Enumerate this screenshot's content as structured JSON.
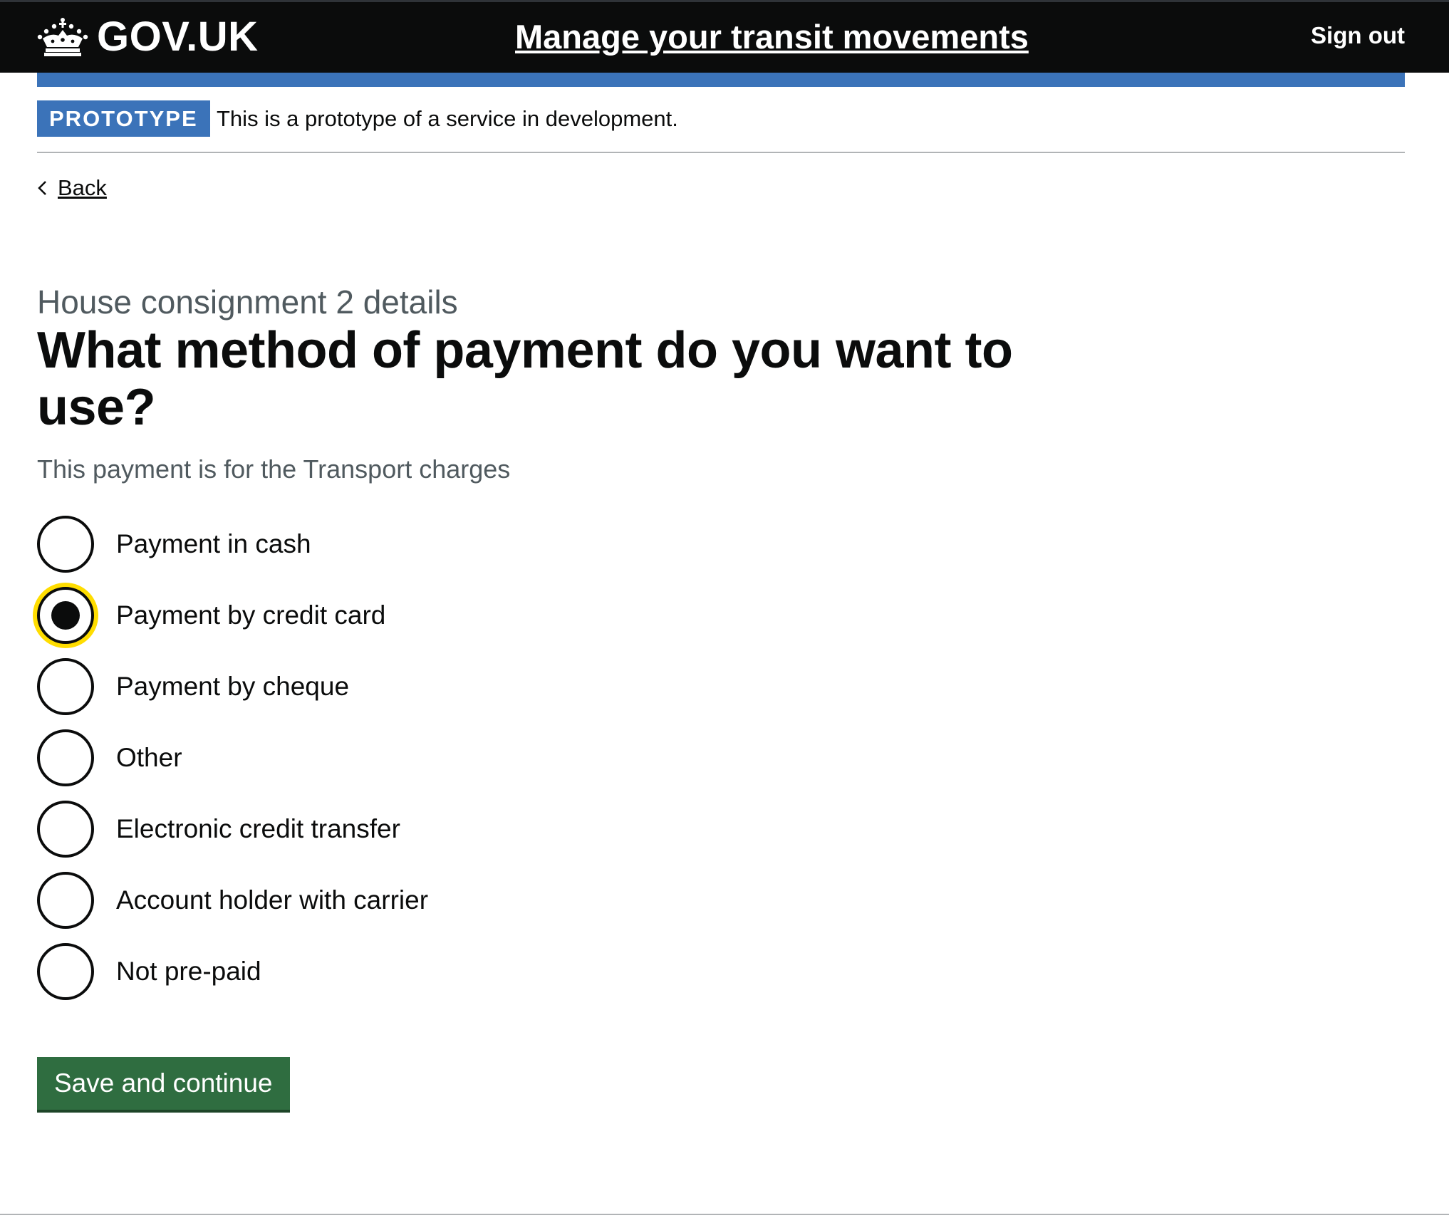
{
  "header": {
    "logo_text": "GOV.UK",
    "logo_icon": "crown-icon",
    "service_name": "Manage your transit movements",
    "sign_out_label": "Sign out"
  },
  "phase_banner": {
    "tag": "PROTOTYPE",
    "text": "This is a prototype of a service in development."
  },
  "back_link": {
    "icon": "chevron-left-icon",
    "label": "Back"
  },
  "page": {
    "caption": "House consignment 2 details",
    "heading": "What method of payment do you want to use?",
    "hint": "This payment is for the Transport charges"
  },
  "radios": {
    "selected": "Payment by credit card",
    "options": [
      {
        "label": "Payment in cash",
        "checked": false
      },
      {
        "label": "Payment by credit card",
        "checked": true
      },
      {
        "label": "Payment by cheque",
        "checked": false
      },
      {
        "label": "Other",
        "checked": false
      },
      {
        "label": "Electronic credit transfer",
        "checked": false
      },
      {
        "label": "Account holder with carrier",
        "checked": false
      },
      {
        "label": "Not pre-paid",
        "checked": false
      }
    ]
  },
  "actions": {
    "submit_label": "Save and continue"
  },
  "colors": {
    "header_bg": "#0b0c0c",
    "brand_blue": "#3b73b9",
    "button_green": "#2f6d40",
    "focus_yellow": "#ffdd00",
    "secondary_text": "#505a5f"
  }
}
